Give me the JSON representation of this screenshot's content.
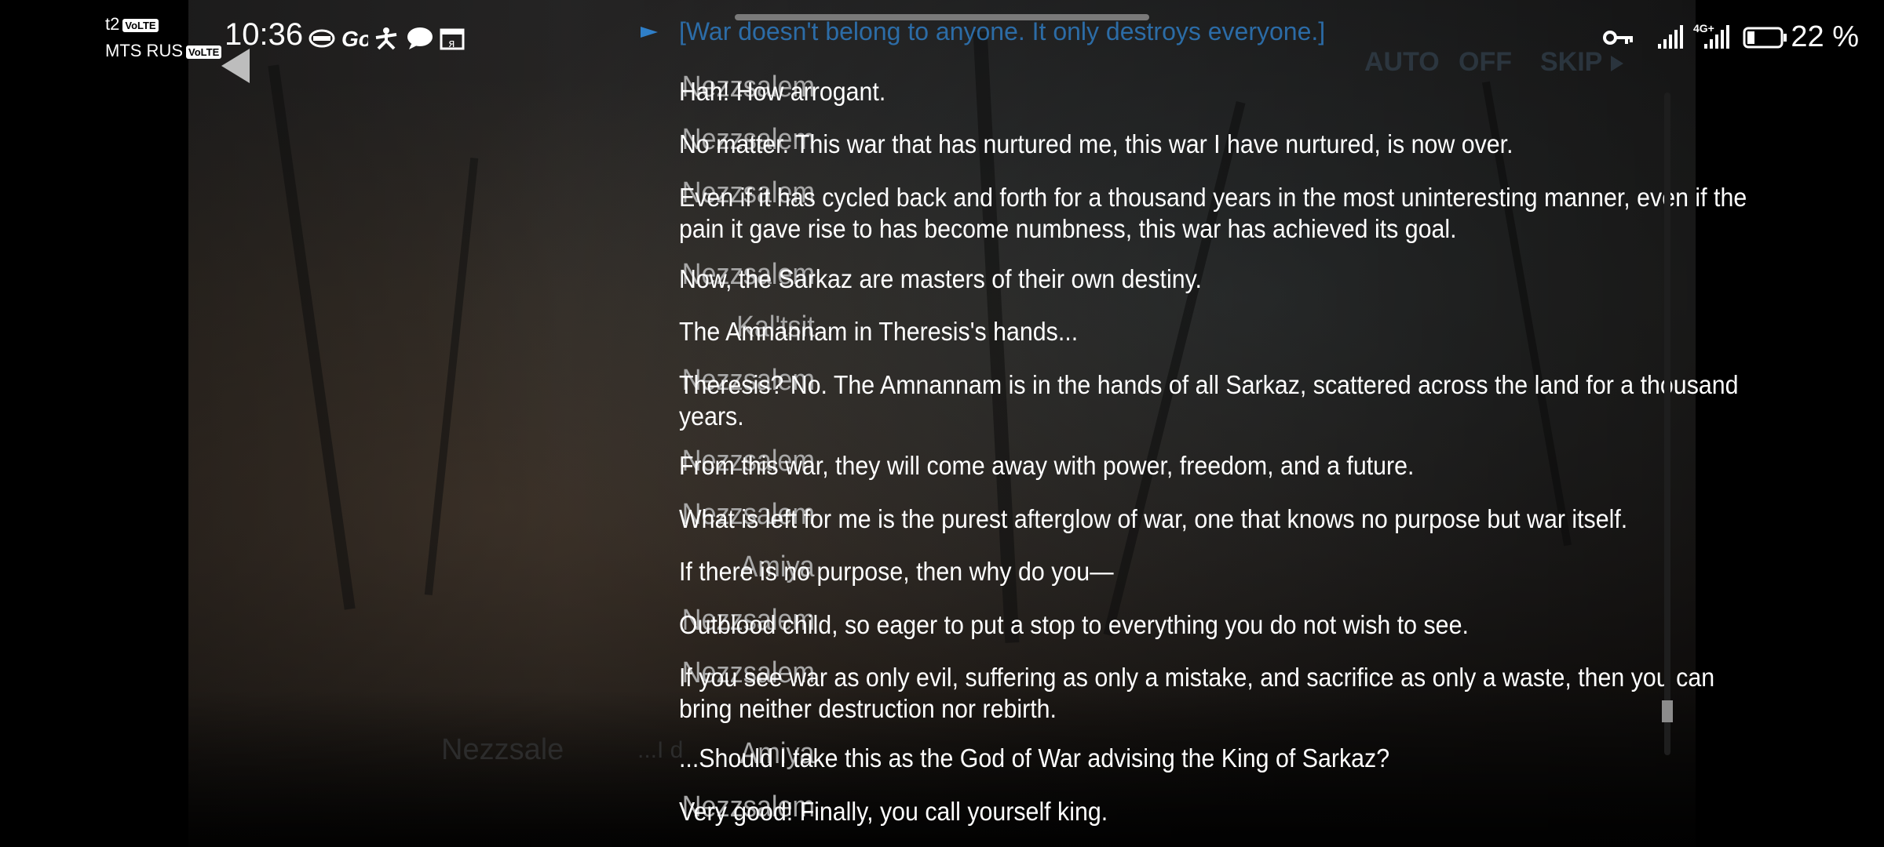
{
  "status_bar": {
    "carrier_top": "t2",
    "carrier_bottom": "MTS RUS",
    "volte_label": "VoLTE",
    "time": "10:36",
    "network_label": "4G+",
    "battery_percent": "22 %",
    "battery_level": 0.22,
    "icons": [
      "key-icon",
      "signal-icon",
      "battery-icon",
      "chat-icon",
      "calendar-icon"
    ]
  },
  "header": {
    "top_line": "[War doesn't belong to anyone. It only destroys everyone.]",
    "auto_label": "AUTO",
    "off_label": "OFF",
    "skip_label": "SKIP"
  },
  "log": {
    "entries": [
      {
        "speaker": "Nezzsalem",
        "text": "Hah! How arrogant."
      },
      {
        "speaker": "Nezzsalem",
        "text": "No matter. This war that has nurtured me, this war I have nurtured, is now over."
      },
      {
        "speaker": "Nezzsalem",
        "text": "Even if it has cycled back and forth for a thousand years in the most uninteresting manner, even if the pain it gave rise to has become numbness, this war has achieved its goal."
      },
      {
        "speaker": "Nezzsalem",
        "text": "Now, the Sarkaz are masters of their own destiny."
      },
      {
        "speaker": "Kal'tsit",
        "text": "The Amnannam in Theresis's hands..."
      },
      {
        "speaker": "Nezzsalem",
        "text": "Theresis? No. The Amnannam is in the hands of all Sarkaz, scattered across the land for a thousand years."
      },
      {
        "speaker": "Nezzsalem",
        "text": "From this war, they will come away with power, freedom, and a future."
      },
      {
        "speaker": "Nezzsalem",
        "text": "What is left for me is the purest afterglow of war, one that knows no purpose but war itself."
      },
      {
        "speaker": "Amiya",
        "text": "If there is no purpose, then why do you—"
      },
      {
        "speaker": "Nezzsalem",
        "text": "Outblood child, so eager to put a stop to everything you do not wish to see."
      },
      {
        "speaker": "Nezzsalem",
        "text": "If you see war as only evil, suffering as only a mistake, and sacrifice as only a waste, then you can bring neither destruction nor rebirth."
      },
      {
        "speaker": "Amiya",
        "text": "...Should I take this as the God of War advising the King of Sarkaz?"
      },
      {
        "speaker": "Nezzsalem",
        "text": "Very good! Finally, you call yourself king."
      }
    ],
    "ghost_speaker": "Nezzsale",
    "ghost_text": "...I d"
  },
  "colors": {
    "speaker": "#a8a8a8",
    "text": "#ffffff",
    "topline": "#2f7fc8"
  }
}
